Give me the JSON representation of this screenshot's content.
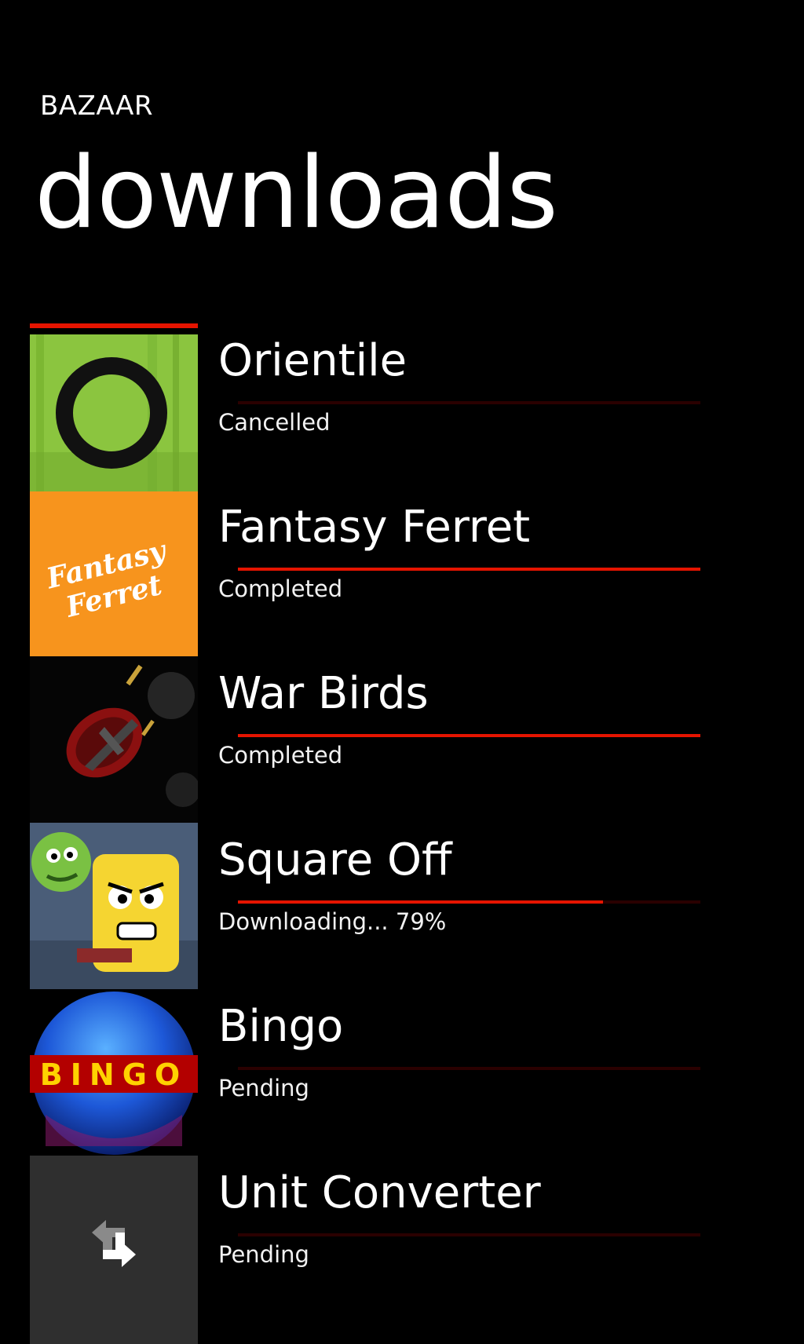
{
  "header": {
    "app_name": "BAZAAR",
    "title": "downloads"
  },
  "colors": {
    "background": "#000000",
    "accent": "#e51400",
    "track": "#2a0000",
    "text": "#ffffff"
  },
  "downloads": [
    {
      "title": "Orientile",
      "status": "Cancelled",
      "progress": 0,
      "icon": "orientile-icon"
    },
    {
      "title": "Fantasy Ferret",
      "status": "Completed",
      "progress": 1,
      "icon": "fantasy-ferret-icon",
      "icon_text": [
        "Fantasy",
        "Ferret"
      ]
    },
    {
      "title": "War Birds",
      "status": "Completed",
      "progress": 1,
      "icon": "war-birds-icon"
    },
    {
      "title": "Square Off",
      "status": "Downloading... 79%",
      "progress": 0.79,
      "icon": "square-off-icon"
    },
    {
      "title": "Bingo",
      "status": "Pending",
      "progress": 0,
      "icon": "bingo-icon",
      "icon_text": "BINGO"
    },
    {
      "title": "Unit Converter",
      "status": "Pending",
      "progress": 0,
      "icon": "unit-converter-icon"
    }
  ]
}
